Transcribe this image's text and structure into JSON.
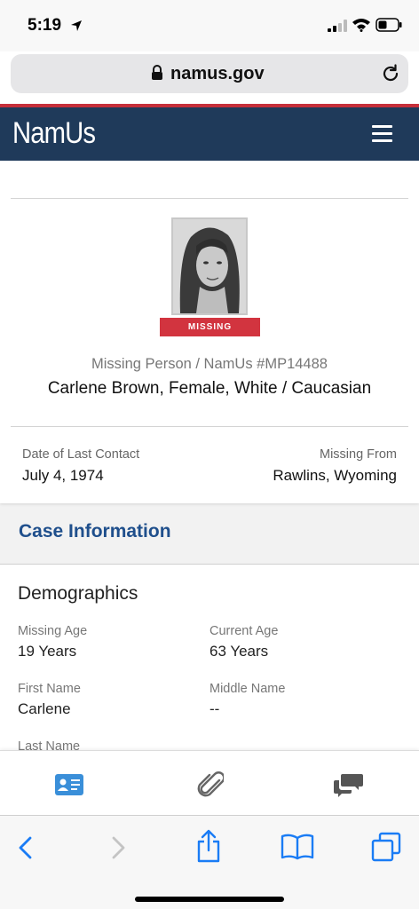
{
  "status_bar": {
    "time": "5:19",
    "icons": [
      "location-arrow-icon",
      "signal-icon",
      "wifi-icon",
      "battery-icon"
    ]
  },
  "browser": {
    "url": "namus.gov",
    "icons": [
      "lock-icon",
      "reload-icon"
    ]
  },
  "header": {
    "brand": "NamUs",
    "menu_icon": "hamburger-menu-icon",
    "background": "#1f3a5a",
    "accent_line": "#c62f3a"
  },
  "profile": {
    "photo": "portrait-photo",
    "status_badge": "MISSING",
    "badge_color": "#d2343f",
    "case_label": "Missing Person / NamUs #MP14488",
    "name_line": "Carlene Brown, Female, White / Caucasian",
    "last_contact_label": "Date of Last Contact",
    "last_contact_value": "July 4, 1974",
    "missing_from_label": "Missing From",
    "missing_from_value": "Rawlins, Wyoming"
  },
  "case_info": {
    "title": "Case Information",
    "title_color": "#1f4f8c"
  },
  "demographics": {
    "title": "Demographics",
    "fields": [
      {
        "label": "Missing Age",
        "value": "19 Years"
      },
      {
        "label": "Current Age",
        "value": "63 Years"
      },
      {
        "label": "First Name",
        "value": "Carlene"
      },
      {
        "label": "Middle Name",
        "value": "--"
      },
      {
        "label": "Last Name",
        "value": ""
      }
    ]
  },
  "tab_bar": {
    "tabs": [
      {
        "icon": "id-card-icon",
        "active": true
      },
      {
        "icon": "paperclip-icon",
        "active": false
      },
      {
        "icon": "chat-bubbles-icon",
        "active": false
      }
    ],
    "active_color": "#3a8fd9"
  },
  "safari_toolbar": {
    "icons": [
      "back-icon",
      "forward-icon",
      "share-icon",
      "bookmarks-icon",
      "tabs-icon"
    ],
    "accent_color": "#1a7cf5"
  }
}
